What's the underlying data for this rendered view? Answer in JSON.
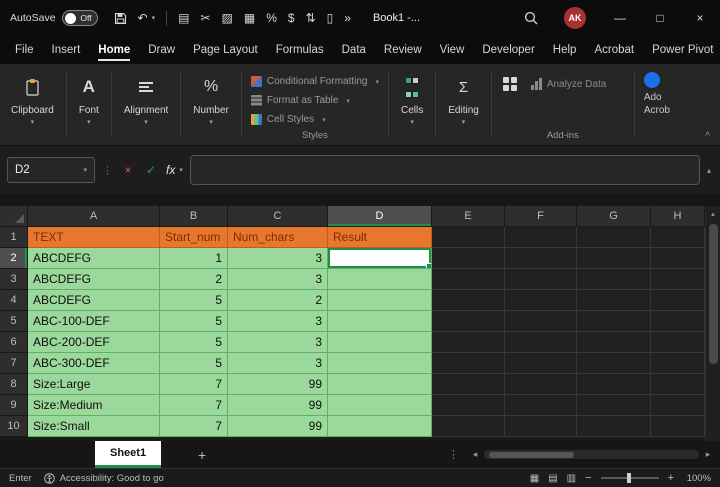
{
  "titlebar": {
    "autosave_label": "AutoSave",
    "autosave_state": "Off",
    "doc_title": "Book1 -...",
    "avatar_initials": "AK"
  },
  "menu": {
    "active": "Home",
    "tabs": [
      {
        "label": "File"
      },
      {
        "label": "Insert"
      },
      {
        "label": "Home"
      },
      {
        "label": "Draw"
      },
      {
        "label": "Page Layout"
      },
      {
        "label": "Formulas"
      },
      {
        "label": "Data"
      },
      {
        "label": "Review"
      },
      {
        "label": "View"
      },
      {
        "label": "Developer"
      },
      {
        "label": "Help"
      },
      {
        "label": "Acrobat"
      },
      {
        "label": "Power Pivot"
      }
    ]
  },
  "ribbon": {
    "groups": {
      "clipboard": "Clipboard",
      "font": "Font",
      "alignment": "Alignment",
      "number": "Number",
      "cells": "Cells",
      "editing": "Editing"
    },
    "styles_items": [
      "Conditional Formatting",
      "Format as Table",
      "Cell Styles"
    ],
    "styles_group_label": "Styles",
    "analyze_data_label": "Analyze Data",
    "addins_group_label": "Add-ins",
    "adobe_line1": "Ado",
    "adobe_line2": "Acrob"
  },
  "formula_bar": {
    "name_box": "D2",
    "fx_label": "fx",
    "formula_value": ""
  },
  "grid": {
    "columns": [
      "A",
      "B",
      "C",
      "D",
      "E",
      "F",
      "G",
      "H"
    ],
    "selected_column": "D",
    "selected_row": 2,
    "active_cell": "D2",
    "rows": [
      {
        "n": 1,
        "cells": [
          "TEXT",
          "Start_num",
          "Num_chars",
          "Result"
        ]
      },
      {
        "n": 2,
        "cells": [
          "ABCDEFG",
          "1",
          "3",
          ""
        ]
      },
      {
        "n": 3,
        "cells": [
          "ABCDEFG",
          "2",
          "3",
          ""
        ]
      },
      {
        "n": 4,
        "cells": [
          "ABCDEFG",
          "5",
          "2",
          ""
        ]
      },
      {
        "n": 5,
        "cells": [
          "ABC-100-DEF",
          "5",
          "3",
          ""
        ]
      },
      {
        "n": 6,
        "cells": [
          "ABC-200-DEF",
          "5",
          "3",
          ""
        ]
      },
      {
        "n": 7,
        "cells": [
          "ABC-300-DEF",
          "5",
          "3",
          ""
        ]
      },
      {
        "n": 8,
        "cells": [
          "Size:Large",
          "7",
          "99",
          ""
        ]
      },
      {
        "n": 9,
        "cells": [
          "Size:Medium",
          "7",
          "99",
          ""
        ]
      },
      {
        "n": 10,
        "cells": [
          "Size:Small",
          "7",
          "99",
          ""
        ]
      }
    ]
  },
  "sheet_bar": {
    "tabs": [
      {
        "label": "Sheet1",
        "active": true
      }
    ],
    "add_label": "+"
  },
  "status_bar": {
    "mode": "Enter",
    "accessibility": "Accessibility: Good to go",
    "zoom": "100%"
  },
  "icons": {
    "chevron_down": "▾",
    "undo": "↶",
    "copy": "▤",
    "cut": "✂",
    "picture": "▨",
    "borders": "▦",
    "percent": "%",
    "currency": "$",
    "sort": "⇅",
    "document": "▯",
    "more": "»",
    "minimize": "—",
    "maximize": "□",
    "close": "×",
    "dots_v": "⋮",
    "cancel": "×",
    "check": "✓",
    "collapse_up": "^",
    "scroll_up": "▴",
    "scroll_left": "◂",
    "scroll_right": "▸",
    "zoom_in": "+",
    "zoom_out": "−",
    "view_normal": "▦",
    "view_layout": "▤",
    "view_break": "▥",
    "sigma": "Σ",
    "font_letter": "A"
  },
  "colors": {
    "accent_green": "#1E8F4E",
    "share_green": "#2E9E5B",
    "header_fill": "#E8772E",
    "header_text": "#7B2C00",
    "data_fill": "#9BD89B",
    "cancel_red": "#E05252",
    "avatar_red": "#A83232",
    "adobe_blue": "#1A6FE8"
  }
}
